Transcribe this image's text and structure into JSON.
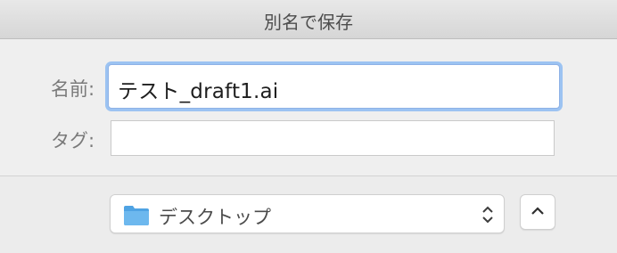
{
  "window": {
    "title": "別名で保存"
  },
  "form": {
    "name_label": "名前:",
    "name_value": "テスト_draft1.ai",
    "tag_label": "タグ:",
    "tag_value": ""
  },
  "location": {
    "selected": "デスクトップ",
    "icon": "folder-icon"
  },
  "controls": {
    "expand_icon": "chevron-up-icon",
    "updown_icon": "up-down-chevron-icon"
  },
  "colors": {
    "focus_ring": "#9cc3f2",
    "folder_blue": "#5aaee8"
  }
}
